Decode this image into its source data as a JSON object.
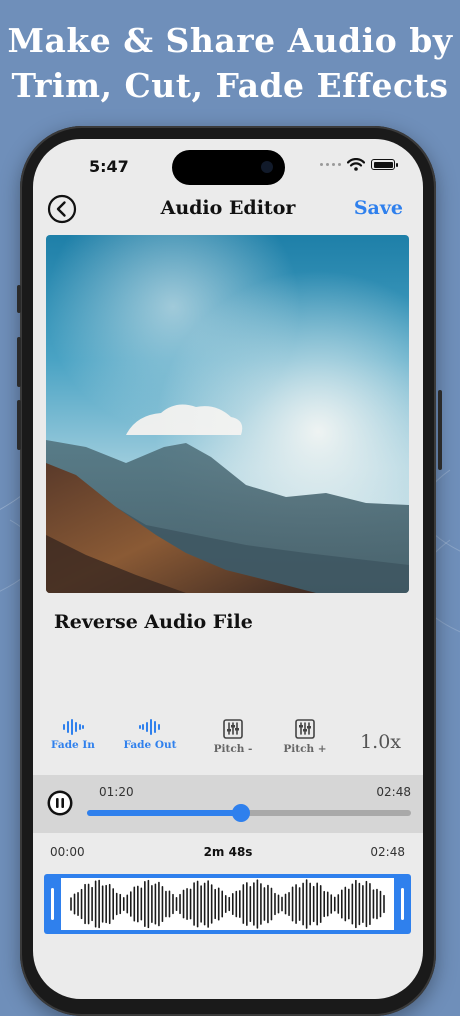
{
  "headline": {
    "line1": "Make & Share Audio by",
    "line2": "Trim, Cut, Fade Effects"
  },
  "status_bar": {
    "time": "5:47"
  },
  "nav": {
    "title": "Audio Editor",
    "save_label": "Save",
    "back_icon": "chevron-left-circle-icon"
  },
  "track": {
    "title": "Reverse Audio File"
  },
  "tools": [
    {
      "label": "Fade In",
      "icon": "waveform-icon",
      "active": true
    },
    {
      "label": "Fade Out",
      "icon": "waveform-icon",
      "active": true
    },
    {
      "label": "Pitch -",
      "icon": "equalizer-sliders-icon",
      "active": false
    },
    {
      "label": "Pitch +",
      "icon": "equalizer-sliders-icon",
      "active": false
    }
  ],
  "speed": "1.0x",
  "player": {
    "current_time": "01:20",
    "total_time": "02:48",
    "progress": 0.476,
    "state_icon": "pause-icon"
  },
  "range": {
    "start": "00:00",
    "duration": "2m 48s",
    "end": "02:48"
  },
  "colors": {
    "accent": "#2f80ed",
    "background": "#6f8fba",
    "screen": "#ebebeb"
  }
}
